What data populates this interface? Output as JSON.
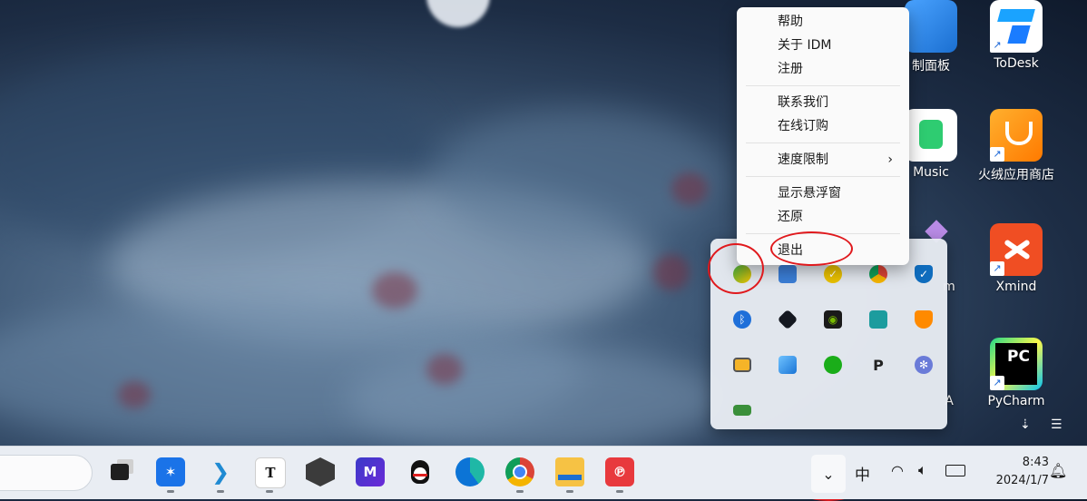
{
  "desktop": {
    "icons": [
      {
        "label": "制面板"
      },
      {
        "label": "ToDesk"
      },
      {
        "label": "Music"
      },
      {
        "label": "火绒应用商店"
      },
      {
        "label": "m"
      },
      {
        "label": "Xmind"
      },
      {
        "label": "A"
      },
      {
        "label": "PyCharm"
      }
    ]
  },
  "context_menu": {
    "items": [
      {
        "label": "帮助"
      },
      {
        "label": "关于 IDM"
      },
      {
        "label": "注册"
      },
      {
        "label": "联系我们"
      },
      {
        "label": "在线订购"
      },
      {
        "label": "速度限制",
        "submenu_arrow": "›"
      },
      {
        "label": "显示悬浮窗"
      },
      {
        "label": "还原"
      },
      {
        "label": "退出"
      }
    ]
  },
  "tray_overflow": {
    "icons": [
      "idm-icon",
      "network-manager-icon",
      "security-check-icon",
      "chrome-icon",
      "defender-icon",
      "bluetooth-icon",
      "dark-app-icon",
      "nvidia-icon",
      "monitor-icon",
      "huorong-icon",
      "window-app-icon",
      "image-tool-icon",
      "wechat-icon",
      "parsec-icon",
      "settings-app-icon",
      "gpu-app-icon"
    ]
  },
  "taskbar": {
    "apps": [
      "task-view-icon",
      "network-app-icon",
      "vscode-icon",
      "typora-icon",
      "unity-icon",
      "mweb-icon",
      "qq-icon",
      "edge-icon",
      "chrome-icon",
      "file-explorer-icon",
      "pdf-app-icon"
    ],
    "tray_toggle_glyph": "⌄",
    "ime": "中",
    "clock": {
      "time": "8:43",
      "date": "2024/1/7"
    }
  },
  "colors": {
    "annotation": "#e0191d",
    "taskbar_bg": "#e9edf3"
  }
}
